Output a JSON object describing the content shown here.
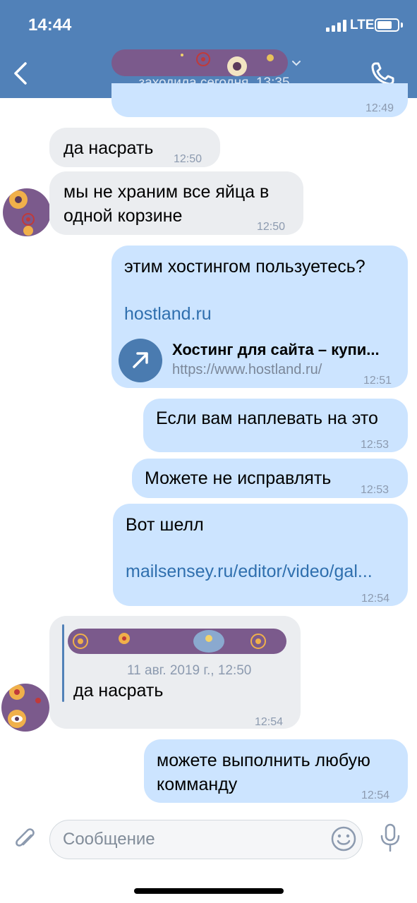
{
  "status_bar": {
    "time": "14:44",
    "network": "LTE"
  },
  "header": {
    "last_seen": "заходила сегодня, 13:35"
  },
  "messages": [
    {
      "direction": "out",
      "time": "12:49"
    },
    {
      "direction": "in",
      "text": "да насрать",
      "time": "12:50"
    },
    {
      "direction": "in",
      "lines": [
        "мы не храним все яйца в",
        "одной корзине"
      ],
      "time": "12:50"
    },
    {
      "direction": "out",
      "text": "этим хостингом пользуетесь?",
      "link": "hostland.ru",
      "preview": {
        "title": "Хостинг для сайта – купи...",
        "url": "https://www.hostland.ru/"
      },
      "time": "12:51"
    },
    {
      "direction": "out",
      "text": "Если вам наплевать на это",
      "time": "12:53"
    },
    {
      "direction": "out",
      "text": "Можете не исправлять",
      "time": "12:53"
    },
    {
      "direction": "out",
      "text": "Вот шелл",
      "link": "mailsensey.ru/editor/video/gal...",
      "time": "12:54"
    },
    {
      "direction": "in",
      "reply": {
        "date": "11 авг. 2019 г., 12:50"
      },
      "text": "да насрать",
      "time": "12:54"
    },
    {
      "direction": "out",
      "lines": [
        "можете выполнить любую",
        "комманду"
      ],
      "time": "12:54"
    }
  ],
  "composer": {
    "placeholder": "Сообщение"
  },
  "colors": {
    "header": "#5181b8",
    "incoming": "#ebedf0",
    "outgoing": "#cce4ff",
    "link": "#2f6fae",
    "redaction": "#7b5a8c"
  }
}
